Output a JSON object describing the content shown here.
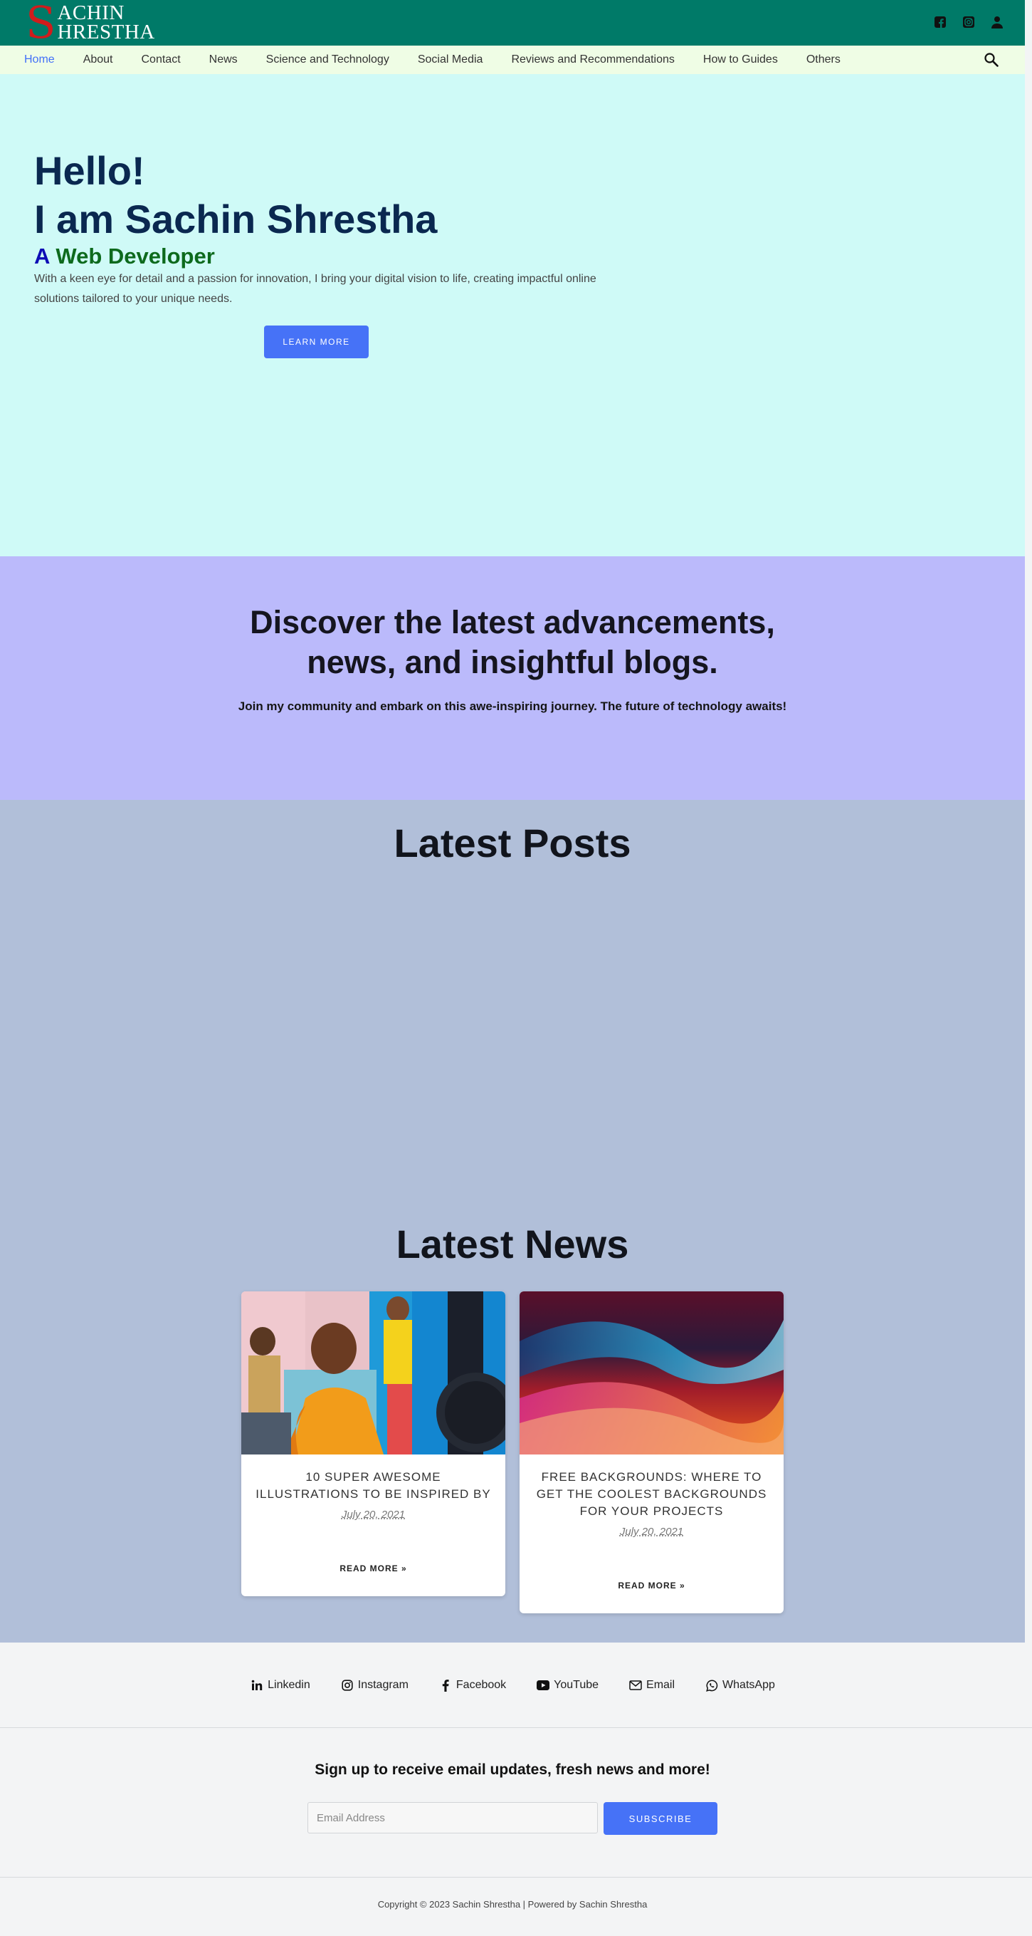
{
  "header": {
    "logo": {
      "initial": "S",
      "line1": "ACHIN",
      "line2": "HRESTHA"
    },
    "icons": [
      "facebook-icon",
      "instagram-icon",
      "user-icon"
    ],
    "brand_color": "#007a68",
    "logo_accent": "#d01c1c"
  },
  "nav": {
    "items": [
      "Home",
      "About",
      "Contact",
      "News",
      "Science and Technology",
      "Social Media",
      "Reviews and Recommendations",
      "How to Guides",
      "Others"
    ],
    "active": "Home",
    "search_icon": "search-icon"
  },
  "hero": {
    "line1": "Hello!",
    "line2": "I am Sachin Shrestha",
    "role_prefix": "A",
    "role": "Web Developer",
    "description": "With a keen eye for detail and a passion for innovation, I bring your digital vision to life, creating impactful online solutions tailored to your unique needs.",
    "button": "LEARN MORE",
    "background": "#cffaf7"
  },
  "discover": {
    "heading_line1": "Discover the latest advancements,",
    "heading_line2": "news, and insightful blogs.",
    "subtext": "Join my community and embark on this awe-inspiring journey. The future of technology awaits!",
    "background": "#bbbafb"
  },
  "posts": {
    "heading": "Latest Posts",
    "background": "#b1bfd9"
  },
  "news": {
    "heading": "Latest News",
    "cards": [
      {
        "title": "10 SUPER AWESOME ILLUSTRATIONS TO BE INSPIRED BY",
        "date": "July 20, 2021",
        "read_more": "READ MORE »"
      },
      {
        "title": "FREE BACKGROUNDS: WHERE TO GET THE COOLEST BACKGROUNDS FOR YOUR PROJECTS",
        "date": "July 20, 2021",
        "read_more": "READ MORE »"
      }
    ]
  },
  "footer": {
    "socials": [
      {
        "icon": "linkedin-icon",
        "label": "Linkedin"
      },
      {
        "icon": "instagram-icon",
        "label": "Instagram"
      },
      {
        "icon": "facebook-icon",
        "label": "Facebook"
      },
      {
        "icon": "youtube-icon",
        "label": "YouTube"
      },
      {
        "icon": "email-icon",
        "label": "Email"
      },
      {
        "icon": "whatsapp-icon",
        "label": "WhatsApp"
      }
    ],
    "signup_heading": "Sign up to receive email updates, fresh news and more!",
    "email_placeholder": "Email Address",
    "subscribe_button": "SUBSCRIBE",
    "copyright": "Copyright © 2023 Sachin Shrestha | Powered by Sachin Shrestha",
    "button_color": "#4672f7"
  }
}
